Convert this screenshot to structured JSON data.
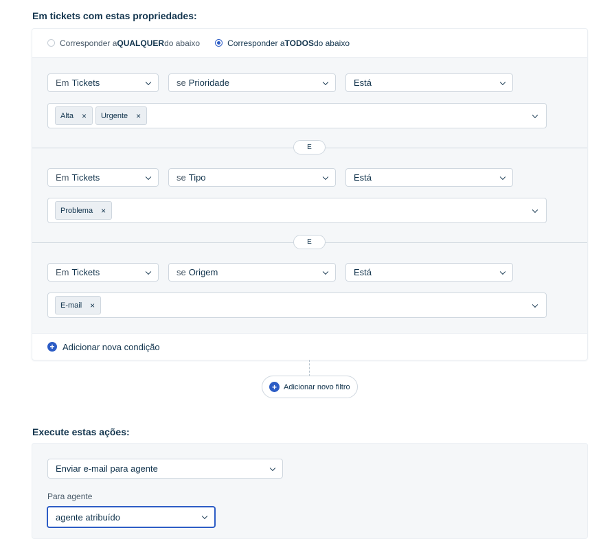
{
  "conditions_section": {
    "title": "Em tickets com estas propriedades:",
    "match_any": {
      "prefix": "Corresponder a ",
      "bold": "QUALQUER",
      "suffix": " do abaixo",
      "selected": false
    },
    "match_all": {
      "prefix": "Corresponder a ",
      "bold": "TODOS",
      "suffix": " do abaixo",
      "selected": true
    },
    "conditions": [
      {
        "entity_prefix": "Em",
        "entity": "Tickets",
        "field_prefix": "se",
        "field": "Prioridade",
        "operator": "Está",
        "values": [
          "Alta",
          "Urgente"
        ]
      },
      {
        "entity_prefix": "Em",
        "entity": "Tickets",
        "field_prefix": "se",
        "field": "Tipo",
        "operator": "Está",
        "values": [
          "Problema"
        ]
      },
      {
        "entity_prefix": "Em",
        "entity": "Tickets",
        "field_prefix": "se",
        "field": "Origem",
        "operator": "Está",
        "values": [
          "E-mail"
        ]
      }
    ],
    "and_label": "E",
    "remove_tag_symbol": "×",
    "add_condition_label": "Adicionar nova condição",
    "add_filter_label": "Adicionar novo filtro"
  },
  "actions_section": {
    "title": "Execute estas ações:",
    "action": "Enviar e-mail para agente",
    "recipient_label": "Para agente",
    "recipient_value": "agente atribuído"
  },
  "colors": {
    "accent": "#2c5cc5",
    "text": "#12344d",
    "panel_bg": "#f5f7f9",
    "border": "#cfd7df"
  }
}
